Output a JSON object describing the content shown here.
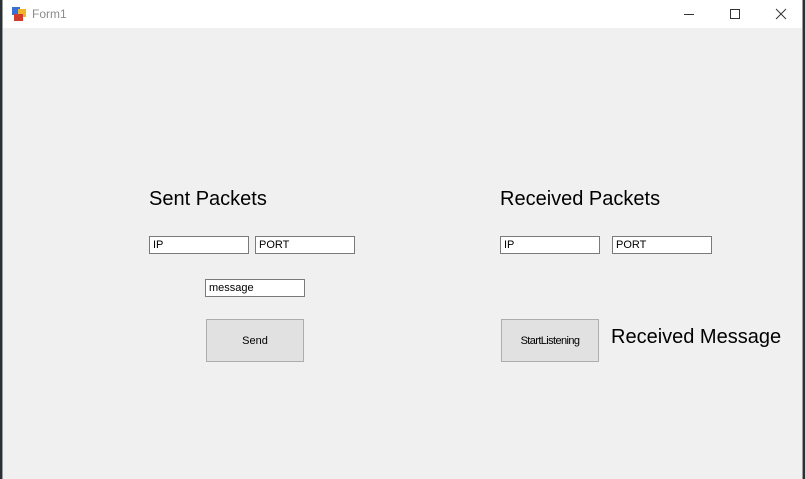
{
  "window": {
    "title": "Form1"
  },
  "sent": {
    "heading": "Sent Packets",
    "ip_value": "IP",
    "port_value": "PORT",
    "message_value": "message",
    "send_label": "Send"
  },
  "received": {
    "heading": "Received Packets",
    "ip_value": "IP",
    "port_value": "PORT",
    "start_label": "StartListening",
    "message_label": "Received Message"
  },
  "icons": {
    "app": "windows-form-icon",
    "minimize": "minimize-icon",
    "maximize": "maximize-icon",
    "close": "close-icon"
  }
}
